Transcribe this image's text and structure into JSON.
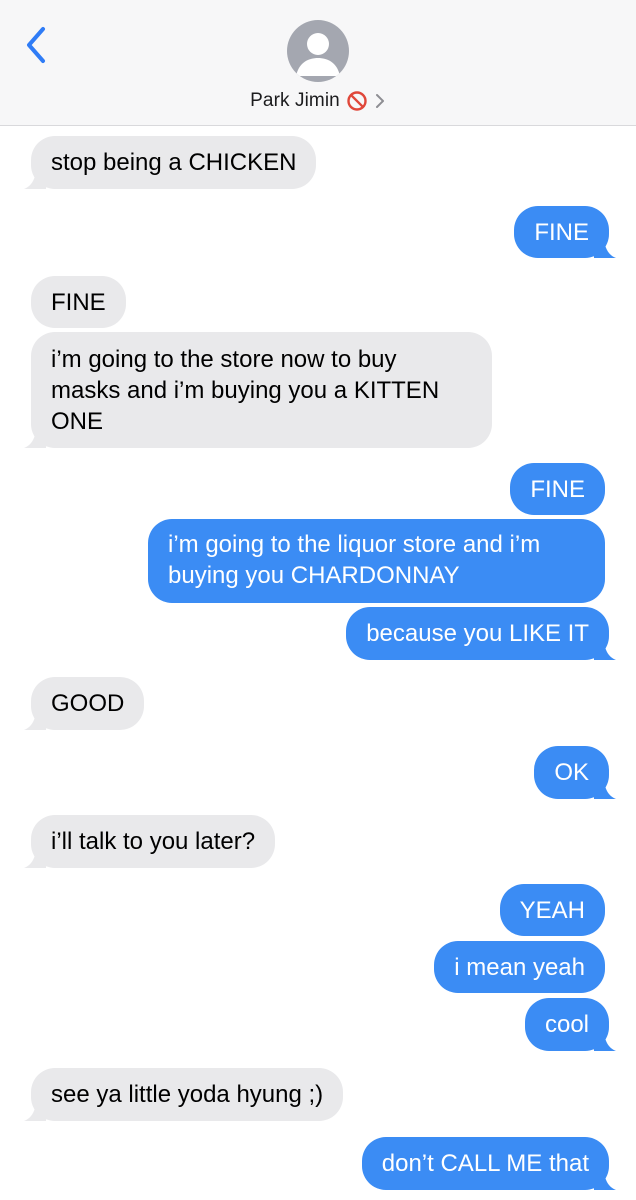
{
  "header": {
    "contact_name": "Park Jimin",
    "back_icon": "chevron-left-icon",
    "avatar_icon": "person-silhouette-icon",
    "blocked_icon": "no-entry-icon",
    "detail_icon": "chevron-right-icon"
  },
  "colors": {
    "incoming_bubble": "#e9e9eb",
    "outgoing_bubble": "#3b8cf4",
    "accent": "#2f7cf6",
    "blocked": "#e0473a"
  },
  "messages": [
    {
      "direction": "incoming",
      "text": "stop being a CHICKEN"
    },
    {
      "direction": "outgoing",
      "text": "FINE"
    },
    {
      "direction": "incoming",
      "text": "FINE"
    },
    {
      "direction": "incoming",
      "text": "i’m going to the store now to buy masks and i’m buying you a KITTEN ONE"
    },
    {
      "direction": "outgoing",
      "text": "FINE"
    },
    {
      "direction": "outgoing",
      "text": "i’m going to the liquor store and i’m buying you CHARDONNAY"
    },
    {
      "direction": "outgoing",
      "text": "because you LIKE IT"
    },
    {
      "direction": "incoming",
      "text": "GOOD"
    },
    {
      "direction": "outgoing",
      "text": "OK"
    },
    {
      "direction": "incoming",
      "text": "i’ll talk to you later?"
    },
    {
      "direction": "outgoing",
      "text": "YEAH"
    },
    {
      "direction": "outgoing",
      "text": "i mean yeah"
    },
    {
      "direction": "outgoing",
      "text": "cool"
    },
    {
      "direction": "incoming",
      "text": "see ya little yoda hyung ;)"
    },
    {
      "direction": "outgoing",
      "text": "don’t CALL ME that"
    }
  ]
}
